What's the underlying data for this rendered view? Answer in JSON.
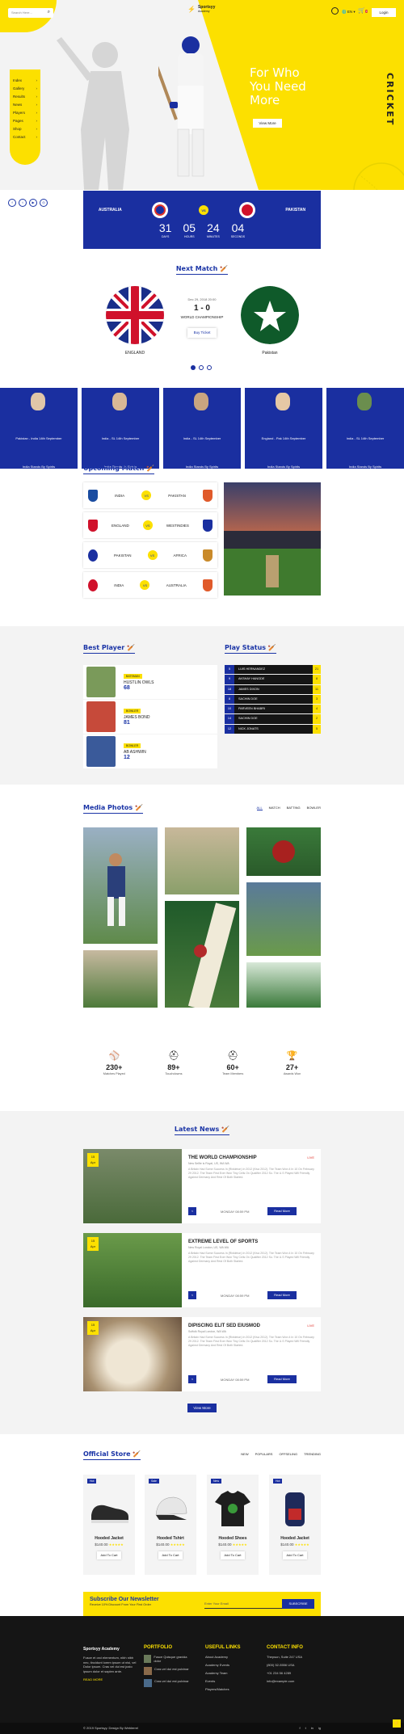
{
  "header": {
    "search_placeholder": "Search Here...",
    "logo_text": "Sportsyy",
    "logo_sub": "Academy",
    "lang": "EN",
    "cart_count": "0",
    "login_label": "Login"
  },
  "menu": [
    "Index",
    "Gallery",
    "Results",
    "News",
    "Players",
    "Pages",
    "Shop",
    "Contact"
  ],
  "hero": {
    "title_lines": [
      "For Who",
      "You Need",
      "More"
    ],
    "button": "View More",
    "vertical": "CRICKET"
  },
  "countdown": {
    "team_left": "AUSTRALIA",
    "team_right": "PAKISTAN",
    "vs": "VS",
    "units": [
      {
        "value": "31",
        "label": "DAYS"
      },
      {
        "value": "05",
        "label": "HOURS"
      },
      {
        "value": "24",
        "label": "MINUTES"
      },
      {
        "value": "04",
        "label": "SECONDS"
      }
    ]
  },
  "next_match": {
    "title": "Next Match",
    "date": "Dec 29, 2018 20:00",
    "score": "1 - 0",
    "event": "WORLD CHAMPIONSHIP",
    "button": "Buy Ticket",
    "left_team": "ENGLAND",
    "right_team": "Pakistan"
  },
  "strip": [
    {
      "line1": "Pakistan - India 14th September",
      "line2": "India Stands By Spirits"
    },
    {
      "line1": "India - SL 14th September",
      "line2": "India Stands By Spirits"
    },
    {
      "line1": "India - SL 14th September",
      "line2": "India Stands By Spirits"
    },
    {
      "line1": "England - Pak 14th September",
      "line2": "India Stands By Spirits"
    },
    {
      "line1": "India - SL 14th September",
      "line2": "India Stands By Spirits"
    }
  ],
  "upcoming": {
    "title": "Upcoming Match",
    "rows": [
      {
        "left": "INDIA",
        "right": "PAKISTAN"
      },
      {
        "left": "ENGLAND",
        "right": "WESTINDIES"
      },
      {
        "left": "PAKISTAN",
        "right": "AFRICA"
      },
      {
        "left": "INDIA",
        "right": "AUSTRALIA"
      }
    ],
    "vs": "VS"
  },
  "best_player": {
    "title": "Best Player",
    "rows": [
      {
        "role": "BATSMAN",
        "name": "HUSTLIN OWLS",
        "score": "68"
      },
      {
        "role": "BOWLER",
        "name": "JAMES BOND",
        "score": "81"
      },
      {
        "role": "BOWLER",
        "name": "AB ASHWIN",
        "score": "12"
      }
    ]
  },
  "play_status": {
    "title": "Play Status",
    "rows": [
      {
        "num": "5",
        "name": "LUIS HERNANDEZ",
        "score": "21"
      },
      {
        "num": "9",
        "name": "AKSHAY HANGDE",
        "score": "8"
      },
      {
        "num": "18",
        "name": "JAMES DIXON",
        "score": "11"
      },
      {
        "num": "8",
        "name": "SACHIN DOE",
        "score": "3"
      },
      {
        "num": "10",
        "name": "PARVEEN BHABRI",
        "score": "4"
      },
      {
        "num": "14",
        "name": "SACHIN DOE",
        "score": "2"
      },
      {
        "num": "12",
        "name": "NICK JONATS",
        "score": "5"
      }
    ]
  },
  "media": {
    "title": "Media Photos",
    "filters": [
      "ALL",
      "MATCH",
      "BATTING",
      "BOWLER"
    ]
  },
  "stats": [
    {
      "value": "230+",
      "label": "Matches Played"
    },
    {
      "value": "89+",
      "label": "Touchdowns"
    },
    {
      "value": "60+",
      "label": "Team Members"
    },
    {
      "value": "27+",
      "label": "Awards Won"
    }
  ],
  "news": {
    "title": "Latest News",
    "items": [
      {
        "day": "15",
        "month": "Apr",
        "title": "THE WORLD CHAMPIONSHIP",
        "meta": "New Selfie is Royal, US, WA WA",
        "body": "A Britain Had Some Success In (Rinkleton) In 2012 (Kiva 2012). The Team Won 4 In 10 On February 29 2012. The Team First Ever Won Tiny Cells On Qualifier 2012 So. The U.S Played Will Friendly Against Germany And Rest Of Both Started.",
        "time": "MONDAY 08:59 PM",
        "btn": "Read More",
        "live": "LIVE"
      },
      {
        "day": "15",
        "month": "Apr",
        "title": "EXTREME LEVEL OF SPORTS",
        "meta": "New Royal London, US, WA WA",
        "body": "A Britain Had Some Success In (Rinkleton) In 2012 (Kiva 2012). The Team Won 4 In 10 On February 29 2012. The Team First Ever Won Tiny Cells On Qualifier 2012 So. The U.S Played Will Friendly Against Germany And Rest Of Both Started.",
        "time": "MONDAY 08:59 PM",
        "btn": "Read More",
        "live": ""
      },
      {
        "day": "15",
        "month": "Apr",
        "title": "DIPISCING ELIT SED EIUSMOD",
        "meta": "Suffolk Royal London, WA WA",
        "body": "A Britain Had Some Success In (Rinkleton) In 2012 (Kiva 2012). The Team Won 4 In 10 On February 29 2012. The Team First Ever Won Tiny Cells On Qualifier 2012 So. The U.S Played Will Friendly Against Germany And Rest Of Both Started.",
        "time": "MONDAY 08:59 PM",
        "btn": "Read More",
        "live": "LIVE"
      }
    ],
    "more": "View More"
  },
  "store": {
    "title": "Official Store",
    "filters": [
      "NEW",
      "POPULARS",
      "OFFSELING",
      "TRENDING"
    ],
    "products": [
      {
        "tag": "Hot",
        "name": "Hooded Jacket",
        "price": "$140.00",
        "btn": "Add To Cart"
      },
      {
        "tag": "Sale",
        "name": "Hooded Tshirt",
        "price": "$140.00",
        "btn": "Add To Cart"
      },
      {
        "tag": "New",
        "name": "Hooded Shoes",
        "price": "$140.00",
        "btn": "Add To Cart"
      },
      {
        "tag": "Hot",
        "name": "Hooded Jacket",
        "price": "$140.00",
        "btn": "Add To Cart"
      }
    ]
  },
  "newsletter": {
    "title": "Subscribe Our Newsletter",
    "sub": "Receive 10% Discount From Your First Order",
    "placeholder": "Enter Your Email",
    "button": "SUBSCRIBE"
  },
  "footer": {
    "logo": "Sportsyy Academy",
    "about": "Fusce et orci elementum, nibh nibh nec, tincidunt lorem ipsum ut nisi, vel Dolor ipsum. Cras vel dui est justo ipsum dolor et sapien ante.",
    "read_more": "READ MORE",
    "portfolio_title": "PORTFOLIO",
    "portfolio": [
      "Fusce Quisque gravida dolor",
      "Cras vel dui est pulvinar",
      "Cras vel dui est pulvinar"
    ],
    "links_title": "USEFUL LINKS",
    "links": [
      "About Academy",
      "Academy Events",
      "Academy Team",
      "Events",
      "Players/Matches"
    ],
    "contact_title": "CONTACT INFO",
    "contact": [
      "Thepsun, Suite 247 USA",
      "(800) 52-5556 USA",
      "+01 234 56 4289",
      "info@example.com"
    ],
    "copyright": "© 2019 Sportsyy. Design By Weblerrel",
    "social": [
      "f",
      "t",
      "in",
      "ig"
    ]
  },
  "colors": {
    "accent": "#fce000",
    "brand": "#1a2fa0"
  }
}
